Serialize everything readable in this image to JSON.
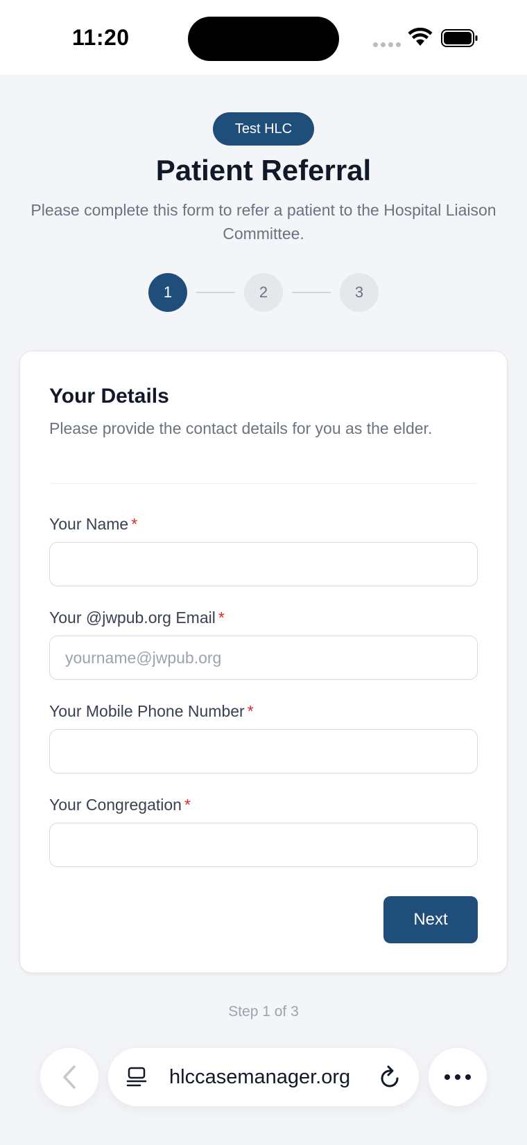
{
  "status_bar": {
    "time": "11:20"
  },
  "header": {
    "org_badge": "Test HLC",
    "title": "Patient Referral",
    "subtitle": "Please complete this form to refer a patient to the Hospital Liaison Committee."
  },
  "stepper": {
    "steps": [
      "1",
      "2",
      "3"
    ],
    "current": 1
  },
  "card": {
    "title": "Your Details",
    "description": "Please provide the contact details for you as the elder.",
    "required_marker": "*",
    "fields": [
      {
        "label": "Your Name",
        "value": "",
        "placeholder": ""
      },
      {
        "label": "Your @jwpub.org Email",
        "value": "",
        "placeholder": "yourname@jwpub.org"
      },
      {
        "label": "Your Mobile Phone Number",
        "value": "",
        "placeholder": ""
      },
      {
        "label": "Your Congregation",
        "value": "",
        "placeholder": ""
      }
    ],
    "next_label": "Next"
  },
  "step_indicator": "Step 1 of 3",
  "browser": {
    "url": "hlccasemanager.org",
    "icons": [
      "chevron-left-icon",
      "reader-icon",
      "reload-icon",
      "more-icon"
    ]
  },
  "colors": {
    "primary": "#1f4e7a",
    "required": "#dc2626",
    "muted": "#6b7280",
    "background": "#f3f5f8"
  }
}
